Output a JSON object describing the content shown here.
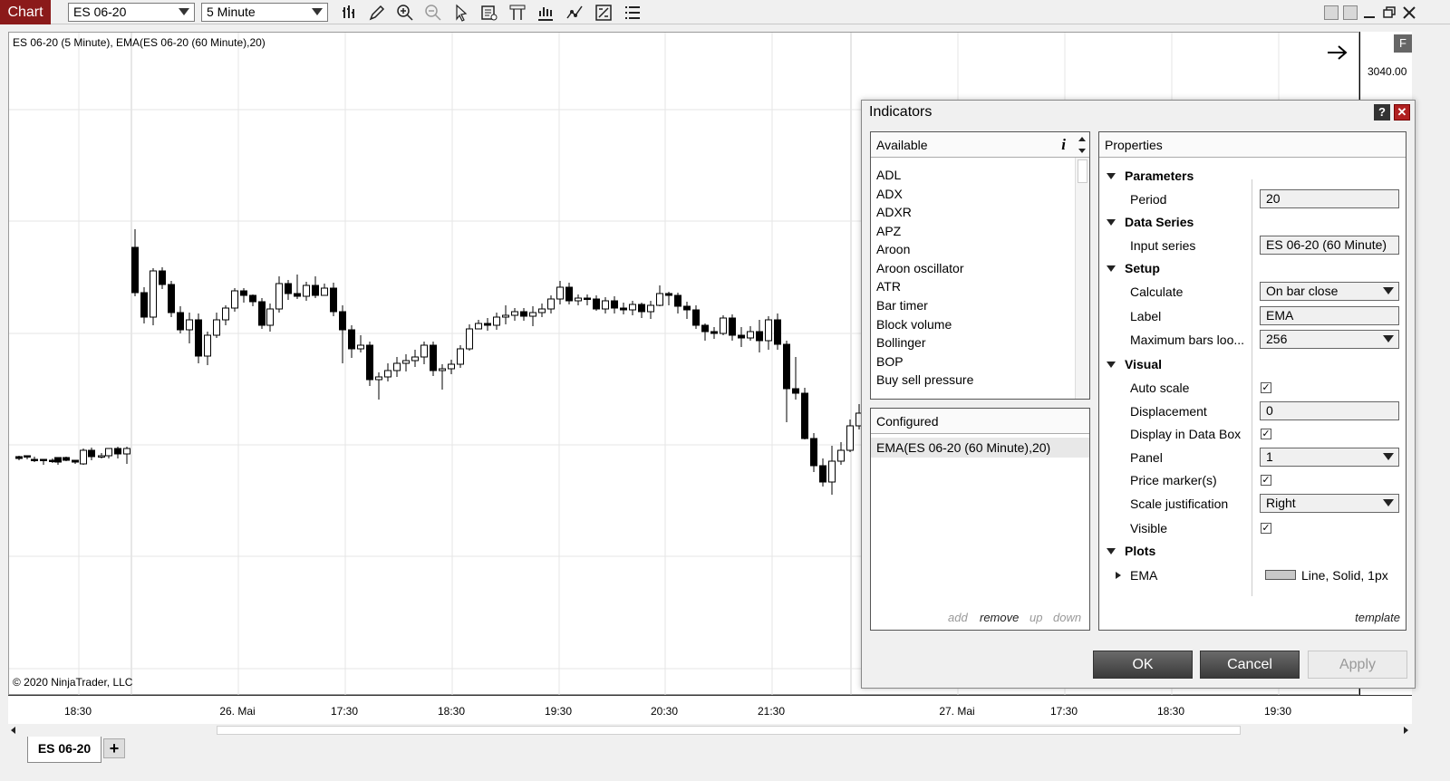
{
  "toolbar": {
    "chart_tab": "Chart",
    "instrument": "ES 06-20",
    "interval": "5 Minute"
  },
  "chart": {
    "title": "ES 06-20 (5 Minute), EMA(ES 06-20 (60 Minute),20)",
    "copyright": "© 2020 NinjaTrader, LLC",
    "price_label": "3040.00",
    "f_button": "F",
    "time_labels": [
      "18:30",
      "26. Mai",
      "17:30",
      "18:30",
      "19:30",
      "20:30",
      "21:30",
      "27. Mai",
      "17:30",
      "18:30",
      "19:30"
    ]
  },
  "tabs": {
    "sheet": "ES 06-20",
    "add": "+"
  },
  "dialog": {
    "title": "Indicators",
    "help": "?",
    "close": "✕",
    "available": {
      "header": "Available",
      "info": "i",
      "items": [
        "ADL",
        "ADX",
        "ADXR",
        "APZ",
        "Aroon",
        "Aroon oscillator",
        "ATR",
        "Bar timer",
        "Block volume",
        "Bollinger",
        "BOP",
        "Buy sell pressure"
      ]
    },
    "configured": {
      "header": "Configured",
      "items": [
        "EMA(ES 06-20 (60 Minute),20)"
      ],
      "add": "add",
      "remove": "remove",
      "up": "up",
      "down": "down"
    },
    "properties": {
      "header": "Properties",
      "parameters": "Parameters",
      "period_label": "Period",
      "period_value": "20",
      "data_series": "Data Series",
      "input_series_label": "Input series",
      "input_series_value": "ES 06-20 (60 Minute)",
      "setup": "Setup",
      "calculate_label": "Calculate",
      "calculate_value": "On bar close",
      "label_label": "Label",
      "label_value": "EMA",
      "max_bars_label": "Maximum bars loo...",
      "max_bars_value": "256",
      "visual": "Visual",
      "auto_scale_label": "Auto scale",
      "displacement_label": "Displacement",
      "displacement_value": "0",
      "data_box_label": "Display in Data Box",
      "panel_label": "Panel",
      "panel_value": "1",
      "price_marker_label": "Price marker(s)",
      "scale_just_label": "Scale justification",
      "scale_just_value": "Right",
      "visible_label": "Visible",
      "plots": "Plots",
      "ema_plot_label": "EMA",
      "ema_plot_value": "Line, Solid, 1px",
      "template": "template",
      "check": "✓"
    },
    "buttons": {
      "ok": "OK",
      "cancel": "Cancel",
      "apply": "Apply"
    }
  },
  "candles": [
    [
      20,
      503,
      505,
      507,
      502
    ],
    [
      29,
      502,
      502,
      506,
      502
    ],
    [
      37,
      506,
      507,
      509,
      503
    ],
    [
      47,
      506,
      507,
      512,
      506
    ],
    [
      57,
      507,
      507,
      510,
      505
    ],
    [
      63,
      504,
      509,
      512,
      505
    ],
    [
      72,
      504,
      507,
      508,
      503
    ],
    [
      82,
      507,
      509,
      511,
      507
    ],
    [
      91,
      511,
      496,
      512,
      494
    ],
    [
      100,
      496,
      503,
      507,
      493
    ],
    [
      111,
      503,
      502,
      505,
      499
    ],
    [
      119,
      502,
      494,
      505,
      494
    ],
    [
      129,
      494,
      500,
      505,
      492
    ],
    [
      139,
      500,
      494,
      511,
      492
    ],
    [
      148,
      272,
      322,
      252,
      326
    ],
    [
      158,
      322,
      349,
      316,
      356
    ],
    [
      168,
      349,
      298,
      295,
      358
    ],
    [
      178,
      298,
      313,
      294,
      318
    ],
    [
      188,
      313,
      344,
      309,
      349
    ],
    [
      198,
      344,
      363,
      337,
      367
    ],
    [
      208,
      363,
      352,
      344,
      378
    ],
    [
      218,
      352,
      392,
      345,
      400
    ],
    [
      228,
      392,
      369,
      365,
      402
    ],
    [
      238,
      369,
      352,
      344,
      372
    ],
    [
      248,
      352,
      339,
      336,
      358
    ],
    [
      258,
      339,
      320,
      317,
      343
    ],
    [
      268,
      320,
      325,
      317,
      333
    ],
    [
      278,
      325,
      332,
      324,
      337
    ],
    [
      288,
      332,
      358,
      328,
      362
    ],
    [
      297,
      358,
      340,
      334,
      365
    ],
    [
      307,
      340,
      312,
      304,
      344
    ],
    [
      317,
      312,
      323,
      308,
      330
    ],
    [
      327,
      323,
      326,
      302,
      329
    ],
    [
      337,
      326,
      314,
      310,
      331
    ],
    [
      347,
      314,
      325,
      304,
      328
    ],
    [
      357,
      325,
      317,
      312,
      324
    ],
    [
      367,
      317,
      343,
      311,
      348
    ],
    [
      377,
      343,
      363,
      336,
      400
    ],
    [
      387,
      363,
      384,
      358,
      394
    ],
    [
      397,
      384,
      380,
      369,
      388
    ],
    [
      407,
      380,
      418,
      376,
      425
    ],
    [
      417,
      418,
      415,
      410,
      440
    ],
    [
      427,
      415,
      408,
      400,
      420
    ],
    [
      437,
      408,
      400,
      393,
      415
    ],
    [
      447,
      400,
      397,
      390,
      409
    ],
    [
      457,
      397,
      393,
      385,
      404
    ],
    [
      467,
      393,
      380,
      376,
      401
    ],
    [
      477,
      380,
      408,
      376,
      414
    ],
    [
      487,
      408,
      406,
      401,
      429
    ],
    [
      497,
      406,
      401,
      396,
      412
    ],
    [
      507,
      401,
      384,
      380,
      405
    ],
    [
      517,
      384,
      362,
      357,
      386
    ],
    [
      527,
      362,
      356,
      352,
      361
    ],
    [
      537,
      356,
      358,
      350,
      364
    ],
    [
      547,
      358,
      349,
      344,
      363
    ],
    [
      557,
      349,
      347,
      336,
      357
    ],
    [
      567,
      347,
      343,
      339,
      353
    ],
    [
      577,
      343,
      348,
      339,
      353
    ],
    [
      587,
      348,
      344,
      337,
      359
    ],
    [
      597,
      344,
      340,
      334,
      349
    ],
    [
      607,
      340,
      329,
      325,
      345
    ],
    [
      617,
      329,
      316,
      309,
      335
    ],
    [
      627,
      316,
      331,
      311,
      335
    ],
    [
      637,
      331,
      328,
      324,
      336
    ],
    [
      647,
      328,
      329,
      324,
      336
    ],
    [
      657,
      329,
      340,
      325,
      342
    ],
    [
      667,
      340,
      331,
      327,
      345
    ],
    [
      677,
      331,
      339,
      326,
      345
    ],
    [
      687,
      339,
      341,
      333,
      346
    ],
    [
      697,
      341,
      335,
      331,
      347
    ],
    [
      707,
      335,
      343,
      333,
      350
    ],
    [
      717,
      343,
      336,
      331,
      351
    ],
    [
      727,
      336,
      323,
      314,
      337
    ],
    [
      737,
      323,
      325,
      321,
      336
    ],
    [
      747,
      325,
      337,
      322,
      345
    ],
    [
      757,
      337,
      341,
      332,
      351
    ],
    [
      767,
      341,
      358,
      336,
      362
    ],
    [
      777,
      358,
      365,
      356,
      375
    ],
    [
      787,
      365,
      367,
      360,
      373
    ],
    [
      797,
      367,
      350,
      347,
      369
    ],
    [
      807,
      350,
      369,
      346,
      375
    ],
    [
      817,
      369,
      372,
      360,
      382
    ],
    [
      827,
      372,
      365,
      359,
      375
    ],
    [
      837,
      365,
      375,
      352,
      388
    ],
    [
      847,
      375,
      352,
      348,
      385
    ],
    [
      857,
      352,
      379,
      345,
      385
    ],
    [
      867,
      379,
      428,
      375,
      465
    ],
    [
      877,
      428,
      433,
      393,
      440
    ],
    [
      887,
      433,
      483,
      427,
      484
    ],
    [
      897,
      483,
      513,
      477,
      520
    ],
    [
      907,
      513,
      531,
      505,
      536
    ],
    [
      917,
      531,
      508,
      491,
      545
    ],
    [
      927,
      508,
      496,
      487,
      512
    ],
    [
      937,
      496,
      469,
      462,
      498
    ],
    [
      947,
      469,
      455,
      445,
      473
    ]
  ]
}
